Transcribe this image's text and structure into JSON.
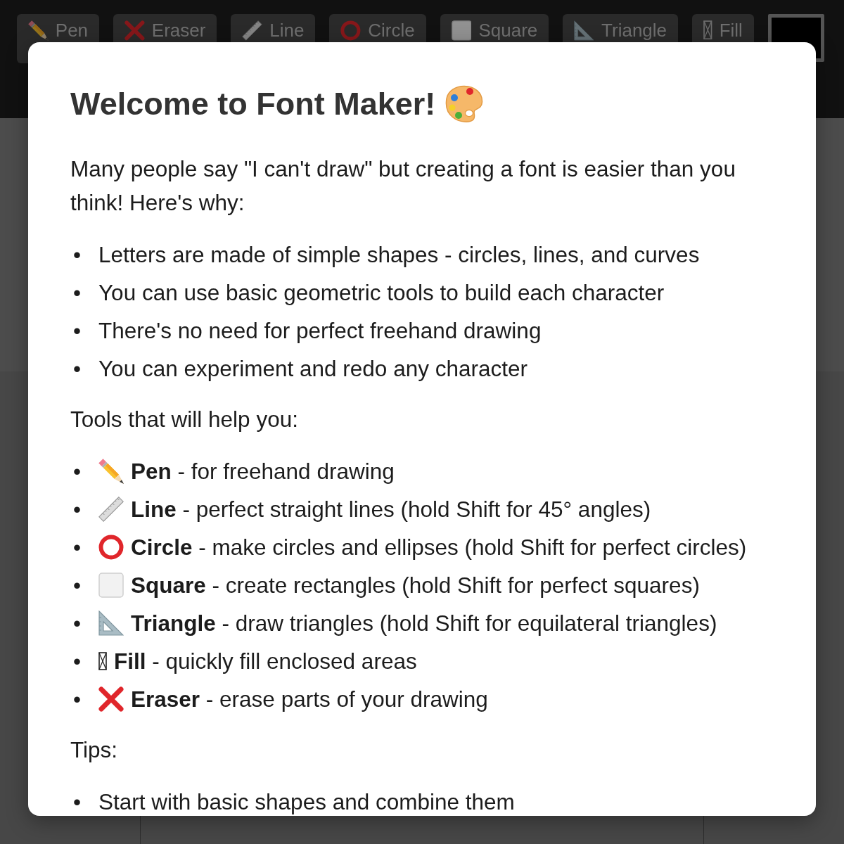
{
  "toolbar": {
    "tools": [
      {
        "kind": "pen",
        "label": "Pen"
      },
      {
        "kind": "eraser",
        "label": "Eraser"
      },
      {
        "kind": "line",
        "label": "Line"
      },
      {
        "kind": "circle",
        "label": "Circle"
      },
      {
        "kind": "square",
        "label": "Square"
      },
      {
        "kind": "triangle",
        "label": "Triangle"
      },
      {
        "kind": "fill",
        "label": "Fill"
      }
    ],
    "color_picker": {
      "color": "#000000"
    }
  },
  "modal": {
    "title": "Welcome to Font Maker!",
    "intro": "Many people say \"I can't draw\" but creating a font is easier than you think! Here's why:",
    "reasons": [
      {
        "bullet": "•",
        "text": "Letters are made of simple shapes - circles, lines, and curves"
      },
      {
        "bullet": "•",
        "text": "You can use basic geometric tools to build each character"
      },
      {
        "bullet": "•",
        "text": "There's no need for perfect freehand drawing"
      },
      {
        "bullet": "•",
        "text": "You can experiment and redo any character"
      }
    ],
    "tools_heading": "Tools that will help you:",
    "tools": [
      {
        "bullet": "•",
        "kind": "pen",
        "text": "**Pen** - for freehand drawing"
      },
      {
        "bullet": "•",
        "kind": "line",
        "text": "**Line** - perfect straight lines (hold Shift for 45° angles)"
      },
      {
        "bullet": "•",
        "kind": "circle",
        "text": "**Circle** - make circles and ellipses (hold Shift for perfect circles)"
      },
      {
        "bullet": "•",
        "kind": "square",
        "text": "**Square** - create rectangles (hold Shift for perfect squares)"
      },
      {
        "bullet": "•",
        "kind": "triangle",
        "text": "**Triangle** - draw triangles (hold Shift for equilateral triangles)"
      },
      {
        "bullet": "•",
        "kind": "fill",
        "text": "**Fill** - quickly fill enclosed areas"
      },
      {
        "bullet": "•",
        "kind": "eraser",
        "text": "**Eraser** - erase parts of your drawing"
      }
    ],
    "tips_heading": "Tips:",
    "tips": [
      {
        "bullet": "•",
        "text": "Start with basic shapes and combine them"
      }
    ]
  }
}
